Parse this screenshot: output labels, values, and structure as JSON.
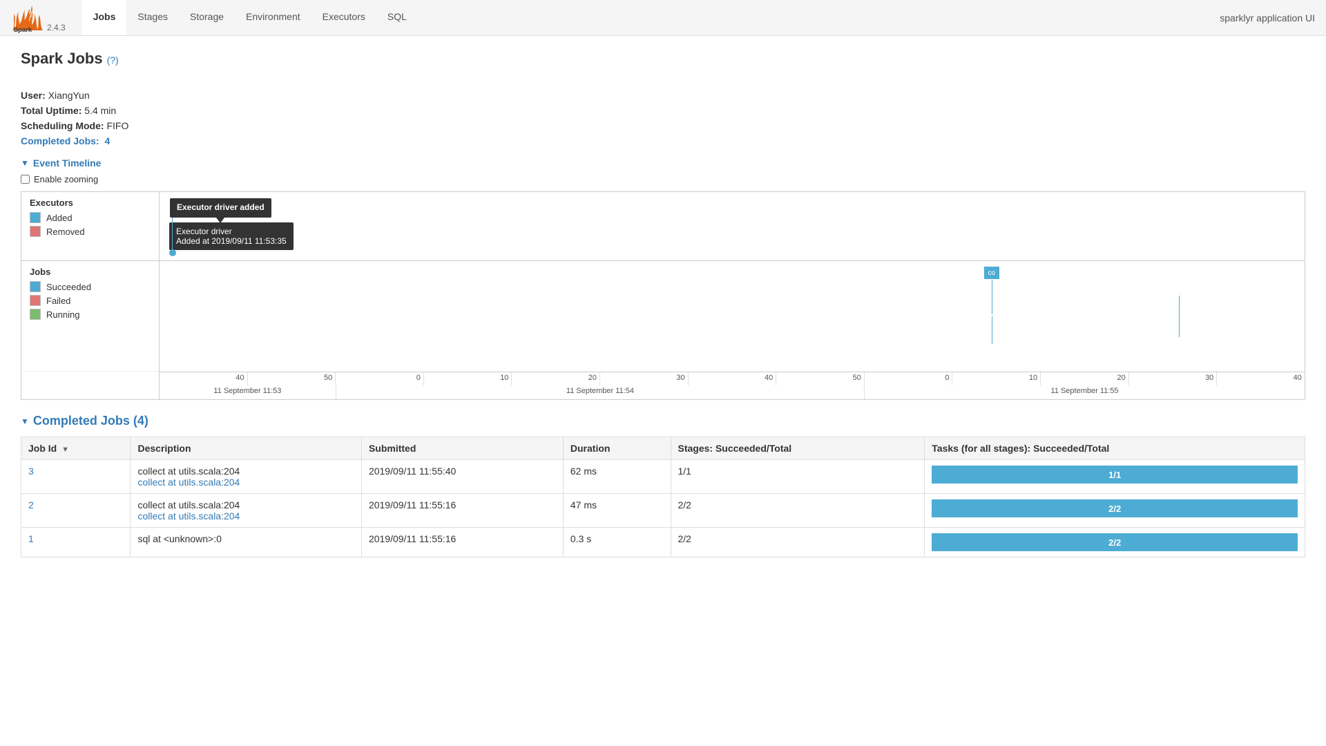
{
  "app": {
    "title": "sparklyr application UI",
    "version": "2.4.3"
  },
  "nav": {
    "links": [
      {
        "label": "Jobs",
        "active": true
      },
      {
        "label": "Stages",
        "active": false
      },
      {
        "label": "Storage",
        "active": false
      },
      {
        "label": "Environment",
        "active": false
      },
      {
        "label": "Executors",
        "active": false
      },
      {
        "label": "SQL",
        "active": false
      }
    ]
  },
  "page": {
    "title": "Spark Jobs",
    "help_text": "(?)"
  },
  "info": {
    "user_label": "User:",
    "user_value": "XiangYun",
    "uptime_label": "Total Uptime:",
    "uptime_value": "5.4 min",
    "scheduling_label": "Scheduling Mode:",
    "scheduling_value": "FIFO",
    "completed_jobs_label": "Completed Jobs:",
    "completed_jobs_value": "4"
  },
  "timeline": {
    "section_label": "Event Timeline",
    "checkbox_label": "Enable zooming",
    "executor_section": "Executors",
    "legend_added": "Added",
    "legend_removed": "Removed",
    "jobs_section": "Jobs",
    "legend_succeeded": "Succeeded",
    "legend_failed": "Failed",
    "legend_running": "Running",
    "tooltip_title": "Executor driver added",
    "tooltip_body_line1": "Executor driver",
    "tooltip_body_line2": "Added at 2019/09/11 11:53:35",
    "axis_labels_1": [
      "40",
      "50",
      "0",
      "10",
      "20",
      "30",
      "40",
      "50",
      "0",
      "10",
      "20",
      "30",
      "40"
    ],
    "date_labels": [
      "11 September 11:53",
      "11 September 11:54",
      "11 September 11:55"
    ]
  },
  "completed_jobs": {
    "section_label": "Completed Jobs (4)",
    "columns": {
      "job_id": "Job Id",
      "description": "Description",
      "submitted": "Submitted",
      "duration": "Duration",
      "stages": "Stages: Succeeded/Total",
      "tasks": "Tasks (for all stages): Succeeded/Total"
    },
    "rows": [
      {
        "id": "3",
        "description_main": "collect at utils.scala:204",
        "description_link": "collect at utils.scala:204",
        "submitted": "2019/09/11 11:55:40",
        "duration": "62 ms",
        "stages": "1/1",
        "tasks": "1/1"
      },
      {
        "id": "2",
        "description_main": "collect at utils.scala:204",
        "description_link": "collect at utils.scala:204",
        "submitted": "2019/09/11 11:55:16",
        "duration": "47 ms",
        "stages": "2/2",
        "tasks": "2/2"
      },
      {
        "id": "1",
        "description_main": "sql at <unknown>:0",
        "description_link": "",
        "submitted": "2019/09/11 11:55:16",
        "duration": "0.3 s",
        "stages": "2/2",
        "tasks": "2/2"
      }
    ]
  }
}
